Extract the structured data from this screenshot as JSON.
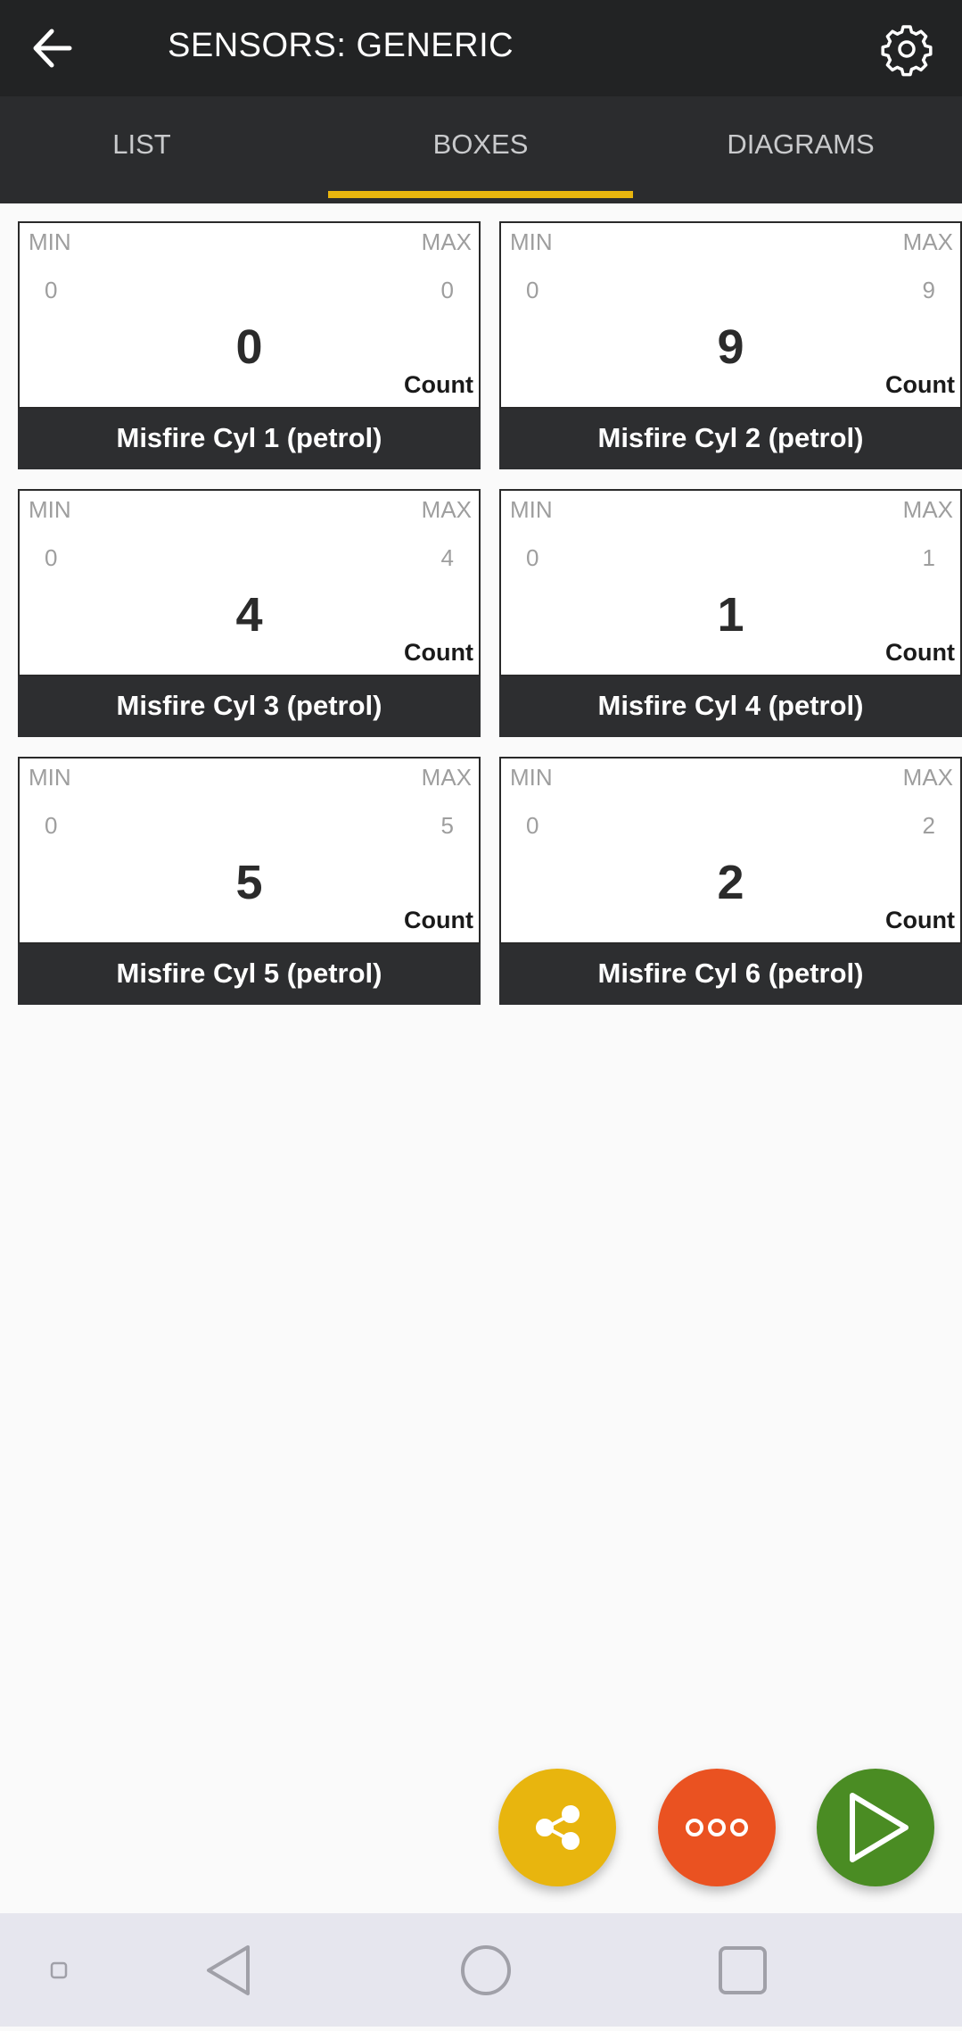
{
  "header": {
    "title": "SENSORS: GENERIC",
    "back_icon": "arrow-left-icon",
    "settings_icon": "gear-icon"
  },
  "tabs": [
    {
      "label": "LIST",
      "active": false
    },
    {
      "label": "BOXES",
      "active": true
    },
    {
      "label": "DIAGRAMS",
      "active": false
    }
  ],
  "labels": {
    "min": "MIN",
    "max": "MAX"
  },
  "sensors": [
    {
      "name": "Misfire Cyl 1 (petrol)",
      "min": "0",
      "max": "0",
      "value": "0",
      "unit": "Count"
    },
    {
      "name": "Misfire Cyl 2 (petrol)",
      "min": "0",
      "max": "9",
      "value": "9",
      "unit": "Count"
    },
    {
      "name": "Misfire Cyl 3 (petrol)",
      "min": "0",
      "max": "4",
      "value": "4",
      "unit": "Count"
    },
    {
      "name": "Misfire Cyl 4 (petrol)",
      "min": "0",
      "max": "1",
      "value": "1",
      "unit": "Count"
    },
    {
      "name": "Misfire Cyl 5 (petrol)",
      "min": "0",
      "max": "5",
      "value": "5",
      "unit": "Count"
    },
    {
      "name": "Misfire Cyl 6 (petrol)",
      "min": "0",
      "max": "2",
      "value": "2",
      "unit": "Count"
    }
  ],
  "fabs": [
    {
      "icon": "share-icon",
      "color": "#e8b50e"
    },
    {
      "icon": "more-dots-icon",
      "color": "#ea5221"
    },
    {
      "icon": "play-icon",
      "color": "#4a8c23"
    }
  ],
  "colors": {
    "accent": "#e8b50e",
    "appbar": "#222324"
  }
}
